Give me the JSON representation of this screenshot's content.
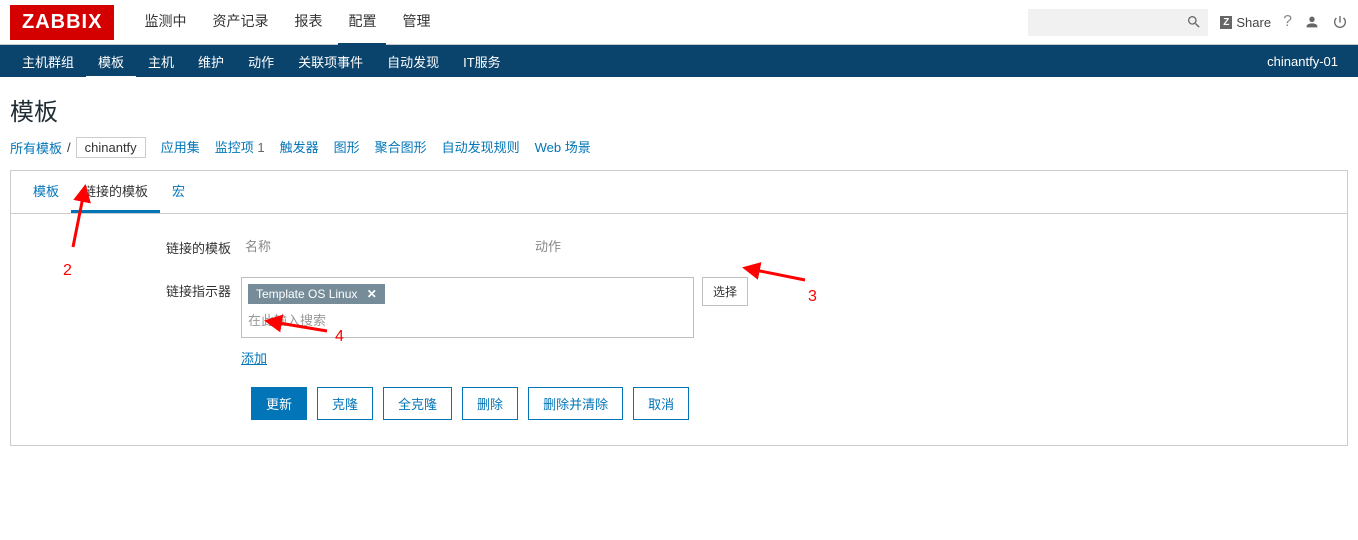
{
  "logo_text": "ZABBIX",
  "top_menu": {
    "items": [
      "监测中",
      "资产记录",
      "报表",
      "配置",
      "管理"
    ],
    "active_index": 3
  },
  "top_right": {
    "share_label": "Share"
  },
  "sub_nav": {
    "items": [
      "主机群组",
      "模板",
      "主机",
      "维护",
      "动作",
      "关联项事件",
      "自动发现",
      "IT服务"
    ],
    "active_index": 1,
    "right_text": "chinantfy-01"
  },
  "page_title": "模板",
  "breadcrumb": {
    "all_templates": "所有模板",
    "separator": "/",
    "current": "chinantfy",
    "suffix_items": [
      {
        "label": "应用集",
        "count": ""
      },
      {
        "label": "监控项",
        "count": "1"
      },
      {
        "label": "触发器",
        "count": ""
      },
      {
        "label": "图形",
        "count": ""
      },
      {
        "label": "聚合图形",
        "count": ""
      },
      {
        "label": "自动发现规则",
        "count": ""
      },
      {
        "label": "Web 场景",
        "count": ""
      }
    ]
  },
  "card_tabs": {
    "items": [
      "模板",
      "链接的模板",
      "宏"
    ],
    "active_index": 1
  },
  "form": {
    "linked_templates_label": "链接的模板",
    "linked_header_name": "名称",
    "linked_header_action": "动作",
    "link_indicator_label": "链接指示器",
    "chip_text": "Template OS Linux",
    "type_here_placeholder": "在此输入搜索",
    "select_btn": "选择",
    "add_link": "添加"
  },
  "buttons": {
    "update": "更新",
    "clone": "克隆",
    "full_clone": "全克隆",
    "delete": "删除",
    "delete_clear": "删除并清除",
    "cancel": "取消"
  },
  "annotations": {
    "n2": "2",
    "n3": "3",
    "n4": "4"
  }
}
